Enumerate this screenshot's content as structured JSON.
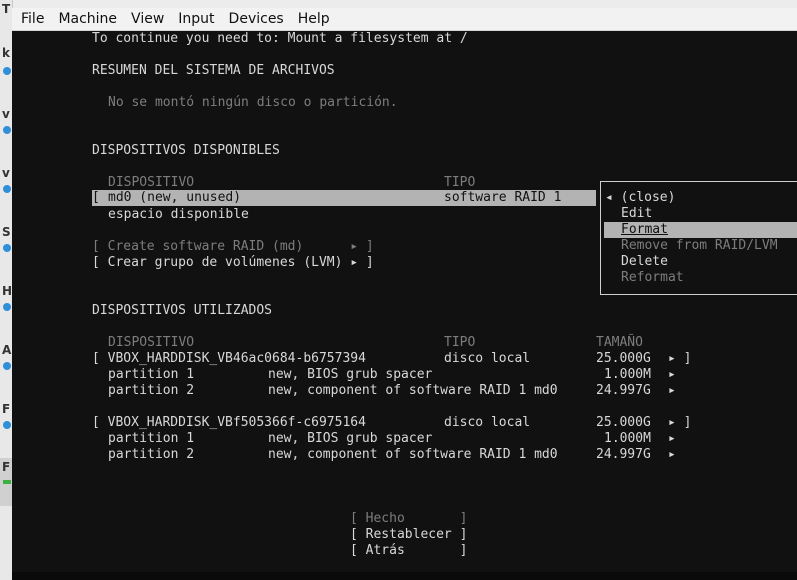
{
  "window": {
    "menu": [
      "File",
      "Machine",
      "View",
      "Input",
      "Devices",
      "Help"
    ],
    "left_strip_letters": [
      "T",
      "k",
      "v",
      "v",
      "S",
      "H",
      "A",
      "F",
      "F"
    ]
  },
  "installer": {
    "notice": "To continue you need to: Mount a filesystem at /",
    "summary_heading": "RESUMEN DEL SISTEMA DE ARCHIVOS",
    "summary_empty": "No se montó ningún disco o partición.",
    "available_heading": "DISPOSITIVOS DISPONIBLES",
    "available_columns": {
      "device": "DISPOSITIVO",
      "type": "TIPO"
    },
    "available_rows": [
      {
        "bracket": "[",
        "device": "md0 (new, unused)",
        "type": "software RAID 1",
        "selected": true
      },
      {
        "device": "espacio disponible"
      }
    ],
    "actions": [
      {
        "label": "[ Create software RAID (md)      ▸ ]",
        "disabled": true
      },
      {
        "label": "[ Crear grupo de volúmenes (LVM) ▸ ]",
        "disabled": false
      }
    ],
    "used_heading": "DISPOSITIVOS UTILIZADOS",
    "used_columns": {
      "device": "DISPOSITIVO",
      "type": "TIPO",
      "size": "TAMAÑO"
    },
    "disks": [
      {
        "name": "[ VBOX_HARDDISK_VB46ac0684-b6757394",
        "type": "disco local",
        "size": "25.000G",
        "arrow": "▸ ]",
        "partitions": [
          {
            "name": "partition 1",
            "desc": "new, BIOS grub spacer",
            "size": "1.000M",
            "arrow": "▸"
          },
          {
            "name": "partition 2",
            "desc": "new, component of software RAID 1 md0",
            "size": "24.997G",
            "arrow": "▸"
          }
        ]
      },
      {
        "name": "[ VBOX_HARDDISK_VBf505366f-c6975164",
        "type": "disco local",
        "size": "25.000G",
        "arrow": "▸ ]",
        "partitions": [
          {
            "name": "partition 1",
            "desc": "new, BIOS grub spacer",
            "size": "1.000M",
            "arrow": "▸"
          },
          {
            "name": "partition 2",
            "desc": "new, component of software RAID 1 md0",
            "size": "24.997G",
            "arrow": "▸"
          }
        ]
      }
    ],
    "buttons": [
      {
        "label": "[ Hecho       ]",
        "disabled": true
      },
      {
        "label": "[ Restablecer ]",
        "disabled": false
      },
      {
        "label": "[ Atrás       ]",
        "disabled": false
      }
    ],
    "popup": {
      "items": [
        {
          "label": "◂ (close)",
          "disabled": false,
          "selected": false
        },
        {
          "label": "Edit",
          "disabled": false,
          "selected": false
        },
        {
          "label": "Format",
          "disabled": false,
          "selected": true
        },
        {
          "label": "Remove from RAID/LVM",
          "disabled": true,
          "selected": false
        },
        {
          "label": "Delete",
          "disabled": false,
          "selected": false
        },
        {
          "label": "Reformat",
          "disabled": true,
          "selected": false
        }
      ]
    }
  }
}
